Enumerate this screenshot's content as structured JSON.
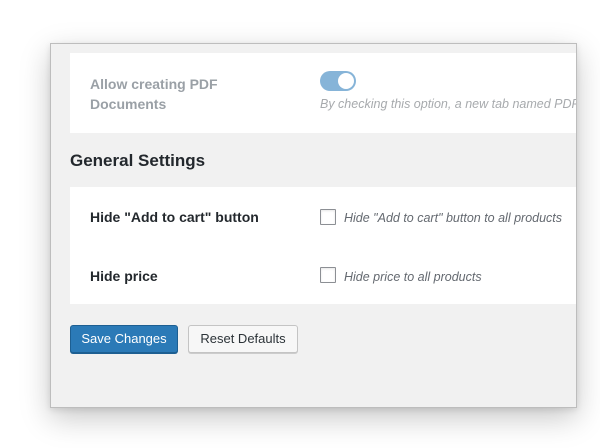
{
  "pdf_section": {
    "label": "Allow creating PDF Documents",
    "toggle_on": true,
    "description": "By checking this option, a new tab named PDF"
  },
  "general_settings": {
    "title": "General Settings",
    "rows": [
      {
        "label": "Hide \"Add to cart\" button",
        "checked": false,
        "description": "Hide \"Add to cart\" button to all products"
      },
      {
        "label": "Hide price",
        "checked": false,
        "description": "Hide price to all products"
      }
    ]
  },
  "actions": {
    "save_label": "Save Changes",
    "reset_label": "Reset Defaults"
  }
}
